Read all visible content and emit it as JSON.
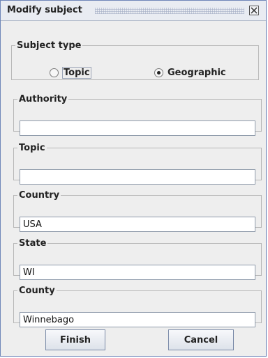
{
  "window": {
    "title": "Modify subject"
  },
  "subject_type": {
    "legend": "Subject type",
    "options": [
      {
        "label": "Topic",
        "selected": false
      },
      {
        "label": "Geographic",
        "selected": true
      }
    ]
  },
  "authority": {
    "legend": "Authority",
    "value": ""
  },
  "topic": {
    "legend": "Topic",
    "value": ""
  },
  "country": {
    "legend": "Country",
    "value": "USA"
  },
  "state": {
    "legend": "State",
    "value": "WI"
  },
  "county": {
    "legend": "County",
    "value": "Winnebago"
  },
  "buttons": {
    "finish": "Finish",
    "cancel": "Cancel"
  },
  "icons": {
    "close": "close-icon"
  }
}
